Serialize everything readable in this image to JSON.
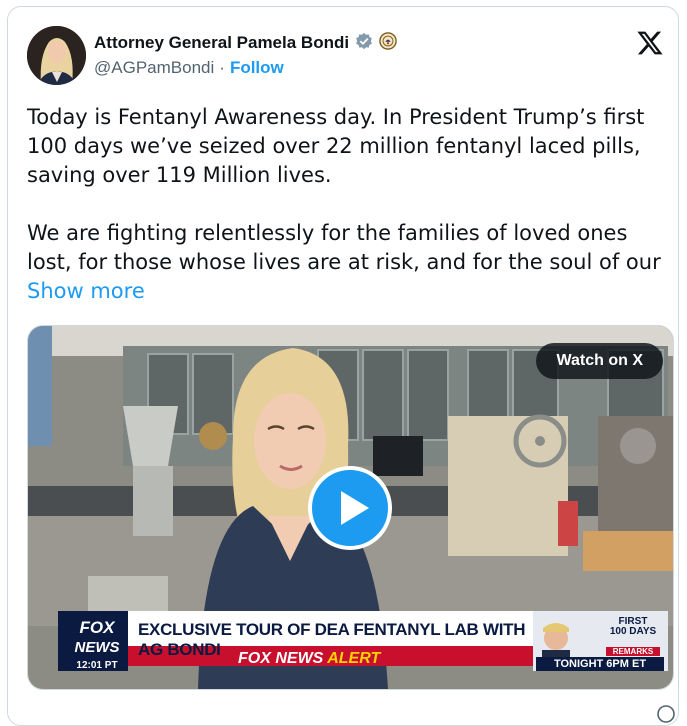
{
  "author": {
    "display_name": "Attorney General Pamela Bondi",
    "handle": "@AGPamBondi",
    "separator": "·",
    "follow_label": "Follow"
  },
  "tweet": {
    "paragraph1": "Today is Fentanyl Awareness day. In President Trump’s first 100 days we’ve seized over 22 million fentanyl laced pills, saving over 119 Million lives.",
    "paragraph2": "We are fighting relentlessly for the families of loved ones lost, for those whose lives are at risk, and for the soul of our",
    "show_more": "Show more"
  },
  "media": {
    "watch_label": "Watch on X",
    "chyron_main": "EXCLUSIVE TOUR OF DEA FENTANYL LAB WITH AG BONDI",
    "chyron_alert_prefix": "FOX NEWS",
    "chyron_alert_word": "ALERT",
    "fox_time": "12:01 PT",
    "fox_logo_text": "FOX NEWS",
    "side_first": "FIRST",
    "side_100": "100 DAYS",
    "side_remarks": "REMARKS",
    "side_tonight": "TONIGHT 6PM ET"
  },
  "icons": {
    "verified": "verified-badge-icon",
    "doj_seal": "doj-seal-icon",
    "platform": "x-logo-icon",
    "play": "play-icon"
  },
  "colors": {
    "link_blue": "#1d9bf0",
    "text": "#0f1419",
    "muted": "#536471",
    "fox_red": "#c8102e",
    "fox_navy": "#0a1a40"
  }
}
